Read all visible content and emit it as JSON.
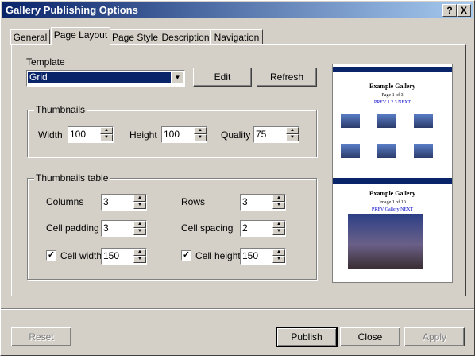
{
  "window": {
    "title": "Gallery Publishing Options",
    "help_label": "?",
    "close_label": "X"
  },
  "tabs": [
    "General",
    "Page Layout",
    "Page Style",
    "Description",
    "Navigation"
  ],
  "active_tab": "Page Layout",
  "template": {
    "label": "Template",
    "value": "Grid",
    "edit_label": "Edit",
    "refresh_label": "Refresh"
  },
  "thumbnails": {
    "title": "Thumbnails",
    "width_label": "Width",
    "width_value": "100",
    "height_label": "Height",
    "height_value": "100",
    "quality_label": "Quality",
    "quality_value": "75"
  },
  "table": {
    "title": "Thumbnails table",
    "columns_label": "Columns",
    "columns_value": "3",
    "rows_label": "Rows",
    "rows_value": "3",
    "padding_label": "Cell padding",
    "padding_value": "3",
    "spacing_label": "Cell spacing",
    "spacing_value": "2",
    "cell_width_label": "Cell width",
    "cell_width_value": "150",
    "cell_width_checked": true,
    "cell_height_label": "Cell height",
    "cell_height_value": "150",
    "cell_height_checked": true
  },
  "preview": {
    "top_heading": "Example Gallery",
    "top_page": "Page 1 of 3",
    "top_nav": "PREV 1 2 3 NEXT",
    "bottom_heading": "Example Gallery",
    "bottom_page": "Image 1 of 10",
    "bottom_nav": "PREV Gallery NEXT"
  },
  "footer": {
    "reset_label": "Reset",
    "publish_label": "Publish",
    "close_label": "Close",
    "apply_label": "Apply"
  }
}
